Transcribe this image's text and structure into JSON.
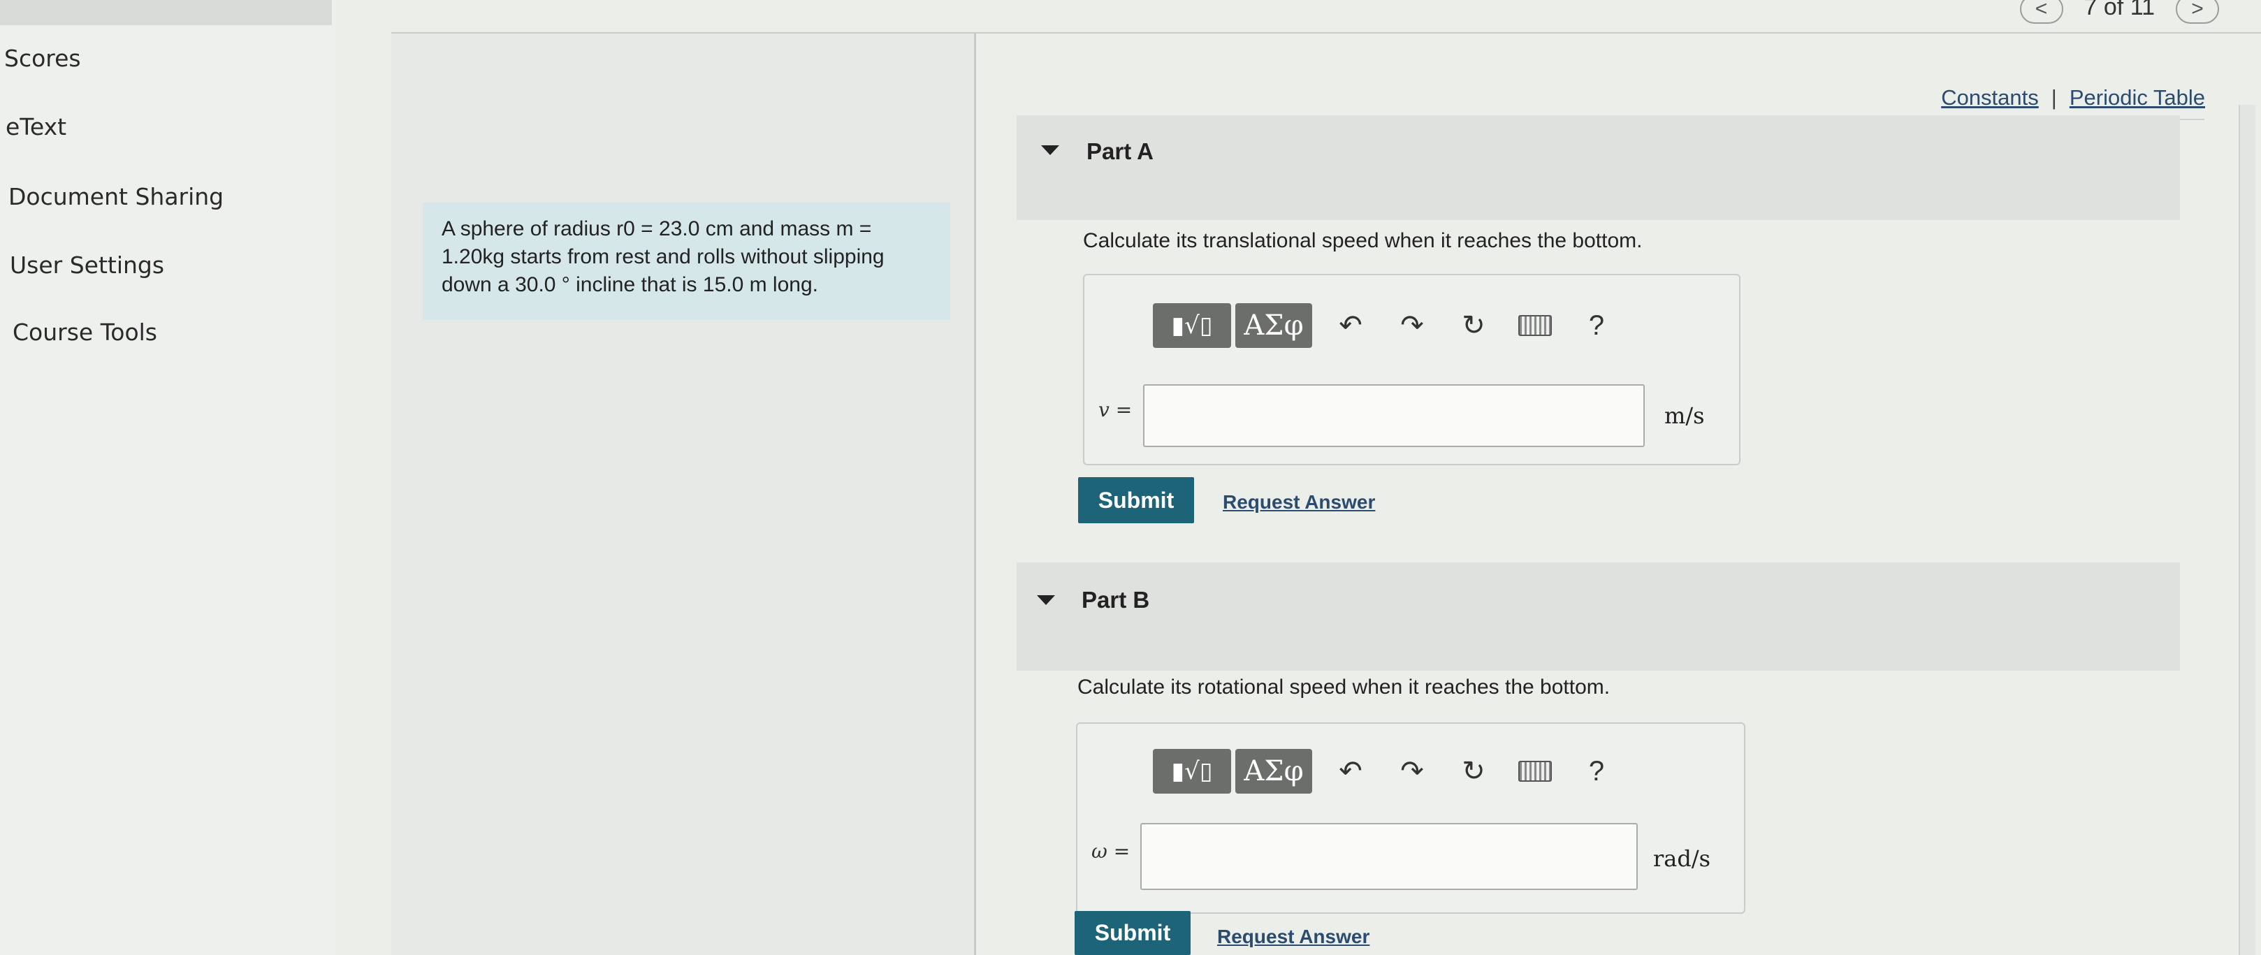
{
  "pager": {
    "prev": "<",
    "count": "7 of 11",
    "next": ">"
  },
  "sidebar": {
    "items": [
      {
        "label": "Scores"
      },
      {
        "label": "eText"
      },
      {
        "label": "Document Sharing"
      },
      {
        "label": "User Settings"
      },
      {
        "label": "Course Tools"
      }
    ]
  },
  "problem": {
    "text": "A sphere of radius r0 = 23.0 cm and mass m = 1.20kg starts from rest and rolls without slipping down a 30.0 ° incline that is 15.0 m long."
  },
  "links": {
    "constants": "Constants",
    "separator": "|",
    "periodic_table": "Periodic Table"
  },
  "toolbar": {
    "templates": "▮√▯",
    "greek": "ΑΣφ",
    "undo": "↶",
    "redo": "↷",
    "reset": "↻",
    "help": "?"
  },
  "parts": [
    {
      "title": "Part A",
      "question": "Calculate its translational speed when it reaches the bottom.",
      "variable": "v =",
      "input_value": "",
      "unit": "m/s",
      "submit": "Submit",
      "request": "Request Answer"
    },
    {
      "title": "Part B",
      "question": "Calculate its rotational speed when it reaches the bottom.",
      "variable": "ω =",
      "input_value": "",
      "unit": "rad/s",
      "submit": "Submit",
      "request": "Request Answer"
    }
  ]
}
